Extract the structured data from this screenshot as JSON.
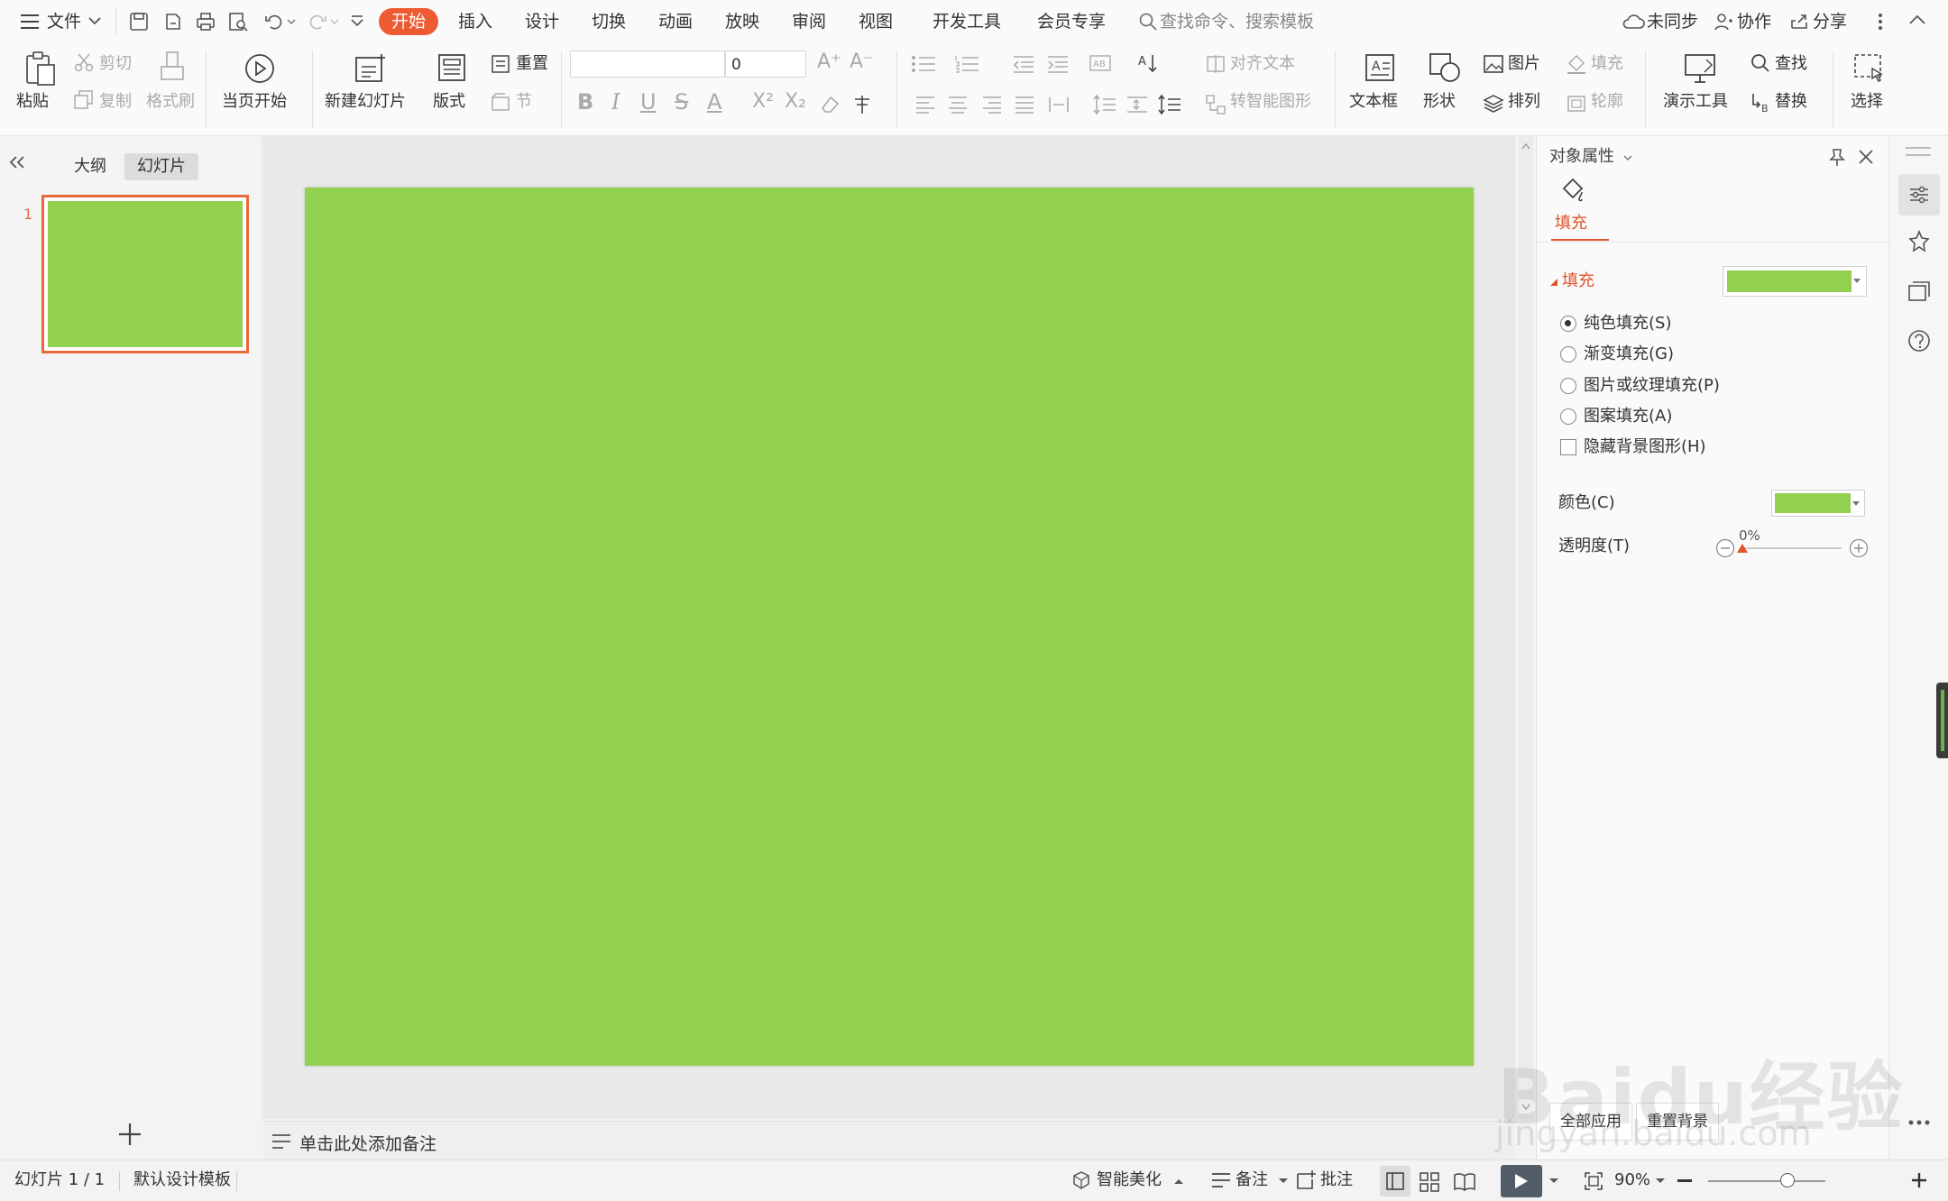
{
  "menubar": {
    "file": "文件",
    "tabs": [
      "开始",
      "插入",
      "设计",
      "切换",
      "动画",
      "放映",
      "审阅",
      "视图",
      "开发工具",
      "会员专享"
    ],
    "active_tab": "开始",
    "search_placeholder": "查找命令、搜索模板",
    "sync": "未同步",
    "collab": "协作",
    "share": "分享"
  },
  "ribbon": {
    "paste": "粘贴",
    "cut": "剪切",
    "copy": "复制",
    "format_painter": "格式刷",
    "from_current": "当页开始",
    "new_slide": "新建幻灯片",
    "layout": "版式",
    "reset": "重置",
    "section": "节",
    "font_size": "0",
    "align_text": "对齐文本",
    "smartart": "转智能图形",
    "textbox": "文本框",
    "shape": "形状",
    "picture": "图片",
    "arrange": "排列",
    "fill": "填充",
    "outline": "轮廓",
    "present_tools": "演示工具",
    "find": "查找",
    "replace": "替换",
    "select": "选择"
  },
  "left_panel": {
    "tab_outline": "大纲",
    "tab_slides": "幻灯片",
    "slide_number": "1"
  },
  "notes": {
    "placeholder": "单击此处添加备注"
  },
  "pane": {
    "title": "对象属性",
    "tab_fill": "填充",
    "section_fill": "填充",
    "options": [
      "纯色填充(S)",
      "渐变填充(G)",
      "图片或纹理填充(P)",
      "图案填充(A)"
    ],
    "hide_bg": "隐藏背景图形(H)",
    "color_label": "颜色(C)",
    "transparency_label": "透明度(T)",
    "transparency_value": "0%",
    "apply_all": "全部应用",
    "reset_bg": "重置背景"
  },
  "status": {
    "slide_info": "幻灯片 1 / 1",
    "template": "默认设计模板",
    "beautify": "智能美化",
    "notes": "备注",
    "comments": "批注",
    "zoom": "90%"
  },
  "watermark": {
    "line1": "Baidu经验",
    "line2": "jingyan.baidu.com"
  },
  "colors": {
    "slide_fill": "#92d050",
    "accent": "#ee5b33"
  }
}
